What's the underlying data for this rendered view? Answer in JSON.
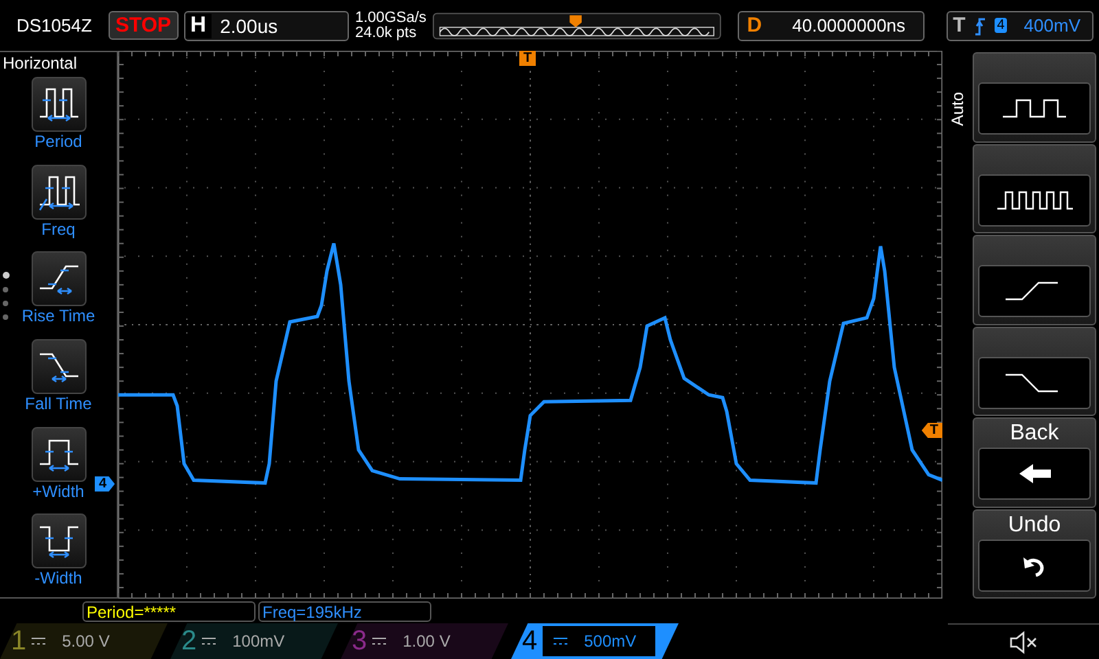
{
  "top_bar": {
    "model": "DS1054Z",
    "run_state": "STOP",
    "running": false,
    "h_label": "H",
    "timebase": "2.00us",
    "sample_rate": "1.00GSa/s",
    "memory_depth": "24.0k pts",
    "delay_label": "D",
    "delay": "40.0000000ns",
    "trigger_label": "T",
    "trigger_source": "4",
    "trigger_level": "400mV"
  },
  "left_menu": {
    "title": "Horizontal",
    "items": [
      {
        "kind": "period",
        "label": "Period"
      },
      {
        "kind": "freq",
        "label": "Freq"
      },
      {
        "kind": "rise",
        "label": "Rise Time"
      },
      {
        "kind": "fall",
        "label": "Fall Time"
      },
      {
        "kind": "pwidth",
        "label": "+Width"
      },
      {
        "kind": "nwidth",
        "label": "-Width"
      }
    ],
    "page_dots": [
      {
        "selected": true
      },
      {
        "selected": false
      },
      {
        "selected": false
      },
      {
        "selected": false
      }
    ]
  },
  "screen": {
    "trigger_position_marker": "T",
    "trigger_level_marker": "T",
    "channel_marker": "4"
  },
  "right_menu": {
    "title": "Auto",
    "items": [
      {
        "kind": "square"
      },
      {
        "kind": "pulses"
      },
      {
        "kind": "rise"
      },
      {
        "kind": "fall"
      },
      {
        "kind": "back",
        "label": "Back"
      },
      {
        "kind": "undo",
        "label": "Undo"
      }
    ]
  },
  "measurements": [
    {
      "text": "Period=*****",
      "color": "#ffff00"
    },
    {
      "text": "Freq=195kHz",
      "color": "#2f8fff"
    }
  ],
  "channels": [
    {
      "number": "1",
      "value": "5.00 V",
      "color": "#8a8628",
      "selected": false
    },
    {
      "number": "2",
      "value": "100mV",
      "color": "#2a8a8a",
      "selected": false
    },
    {
      "number": "3",
      "value": "1.00 V",
      "color": "#8a2a8a",
      "selected": false
    },
    {
      "number": "4",
      "value": "500mV",
      "color": "#1e8fff",
      "selected": true
    }
  ]
}
